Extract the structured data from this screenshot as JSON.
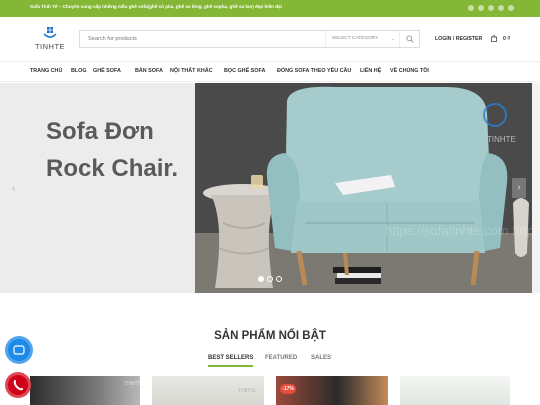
{
  "topbar": {
    "text": "Sofa Tinh Tế – Chuyên cung cấp những mẫu ghế sofa(ghế sô pha, ghế sa lông, ghế sopha, ghế sa lon) đẹp hiện đại",
    "social_icons": [
      "facebook-icon",
      "twitter-icon",
      "email-icon",
      "pinterest-icon",
      "linkedin-icon"
    ]
  },
  "header": {
    "logo_text": "TINHTE",
    "search": {
      "placeholder": "Search for products",
      "category": "SELECT CATEGORY"
    },
    "login_label": "LOGIN / REGISTER",
    "cart_amount": "0 ₫"
  },
  "nav": {
    "items": [
      "TRANG CHỦ",
      "BLOG",
      "GHẾ SOFA",
      "BÀN SOFA",
      "NỘI THẤT KHÁC",
      "BỌC GHẾ SOFA",
      "ĐÓNG SOFA THEO YÊU CẦU",
      "LIÊN HỆ",
      "VỀ CHÚNG TÔI"
    ]
  },
  "hero": {
    "title_line1": "Sofa Đơn",
    "title_line2": "Rock Chair.",
    "watermark": "https://sofatinhte.com   https://sofatinhte.co",
    "photo_logo": "TINHTE",
    "slide_count": 3,
    "active_slide": 1
  },
  "featured": {
    "title": "SẢN PHẨM NỔI BẬT",
    "tabs": [
      "BEST SELLERS",
      "FEATURED",
      "SALES"
    ],
    "active_tab": 0,
    "product_badge": "-17%",
    "product_logo": "TINHTE"
  },
  "colors": {
    "accent": "#83b735",
    "zalo": "#1c8ae8",
    "phone": "#d0021b",
    "sale_badge": "#e74c3c"
  }
}
